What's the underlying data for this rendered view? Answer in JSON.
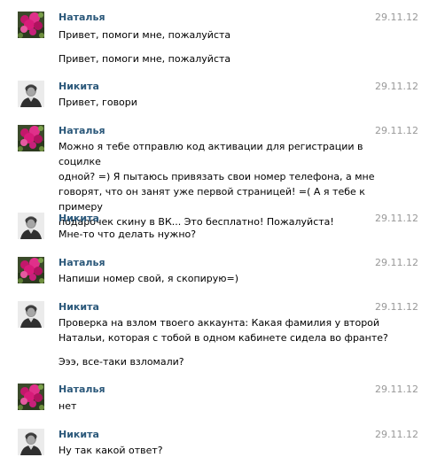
{
  "participants": {
    "natalya": {
      "name": "Наталья",
      "avatar_icon": "pink-flower-avatar-icon"
    },
    "nikita": {
      "name": "Никита",
      "avatar_icon": "man-portrait-avatar-icon"
    }
  },
  "colors": {
    "author_link": "#2b587a",
    "date_text": "#999999",
    "message_text": "#000000"
  },
  "messages": [
    {
      "author": "Наталья",
      "date": "29.11.12",
      "texts": [
        "Привет, помоги мне, пожалуйста",
        "Привет, помоги мне, пожалуйста"
      ]
    },
    {
      "author": "Никита",
      "date": "29.11.12",
      "texts": [
        "Привет, говори"
      ]
    },
    {
      "author": "Наталья",
      "date": "29.11.12",
      "texts": [
        "Можно я тебе отправлю код активации для регистрации в социлке\nодной? =) Я пытаюсь привязать свои номер телефона, а мне\nговорят, что он занят уже первой страницей! =( А я тебе к примеру\nподарочек скину в ВК... Это бесплатно! Пожалуйста!"
      ]
    },
    {
      "author": "Никита",
      "date": "29.11.12",
      "texts": [
        "Мне-то что делать нужно?"
      ]
    },
    {
      "author": "Наталья",
      "date": "29.11.12",
      "texts": [
        "Напиши номер свой, я скопирую=)"
      ]
    },
    {
      "author": "Никита",
      "date": "29.11.12",
      "texts": [
        "Проверка на взлом твоего аккаунта: Какая фамилия у второй\nНатальи, которая с тобой в одном кабинете сидела во франте?",
        "Эээ, все-таки взломали?"
      ]
    },
    {
      "author": "Наталья",
      "date": "29.11.12",
      "texts": [
        "нет"
      ]
    },
    {
      "author": "Никита",
      "date": "29.11.12",
      "texts": [
        "Ну так какой ответ?"
      ]
    }
  ]
}
